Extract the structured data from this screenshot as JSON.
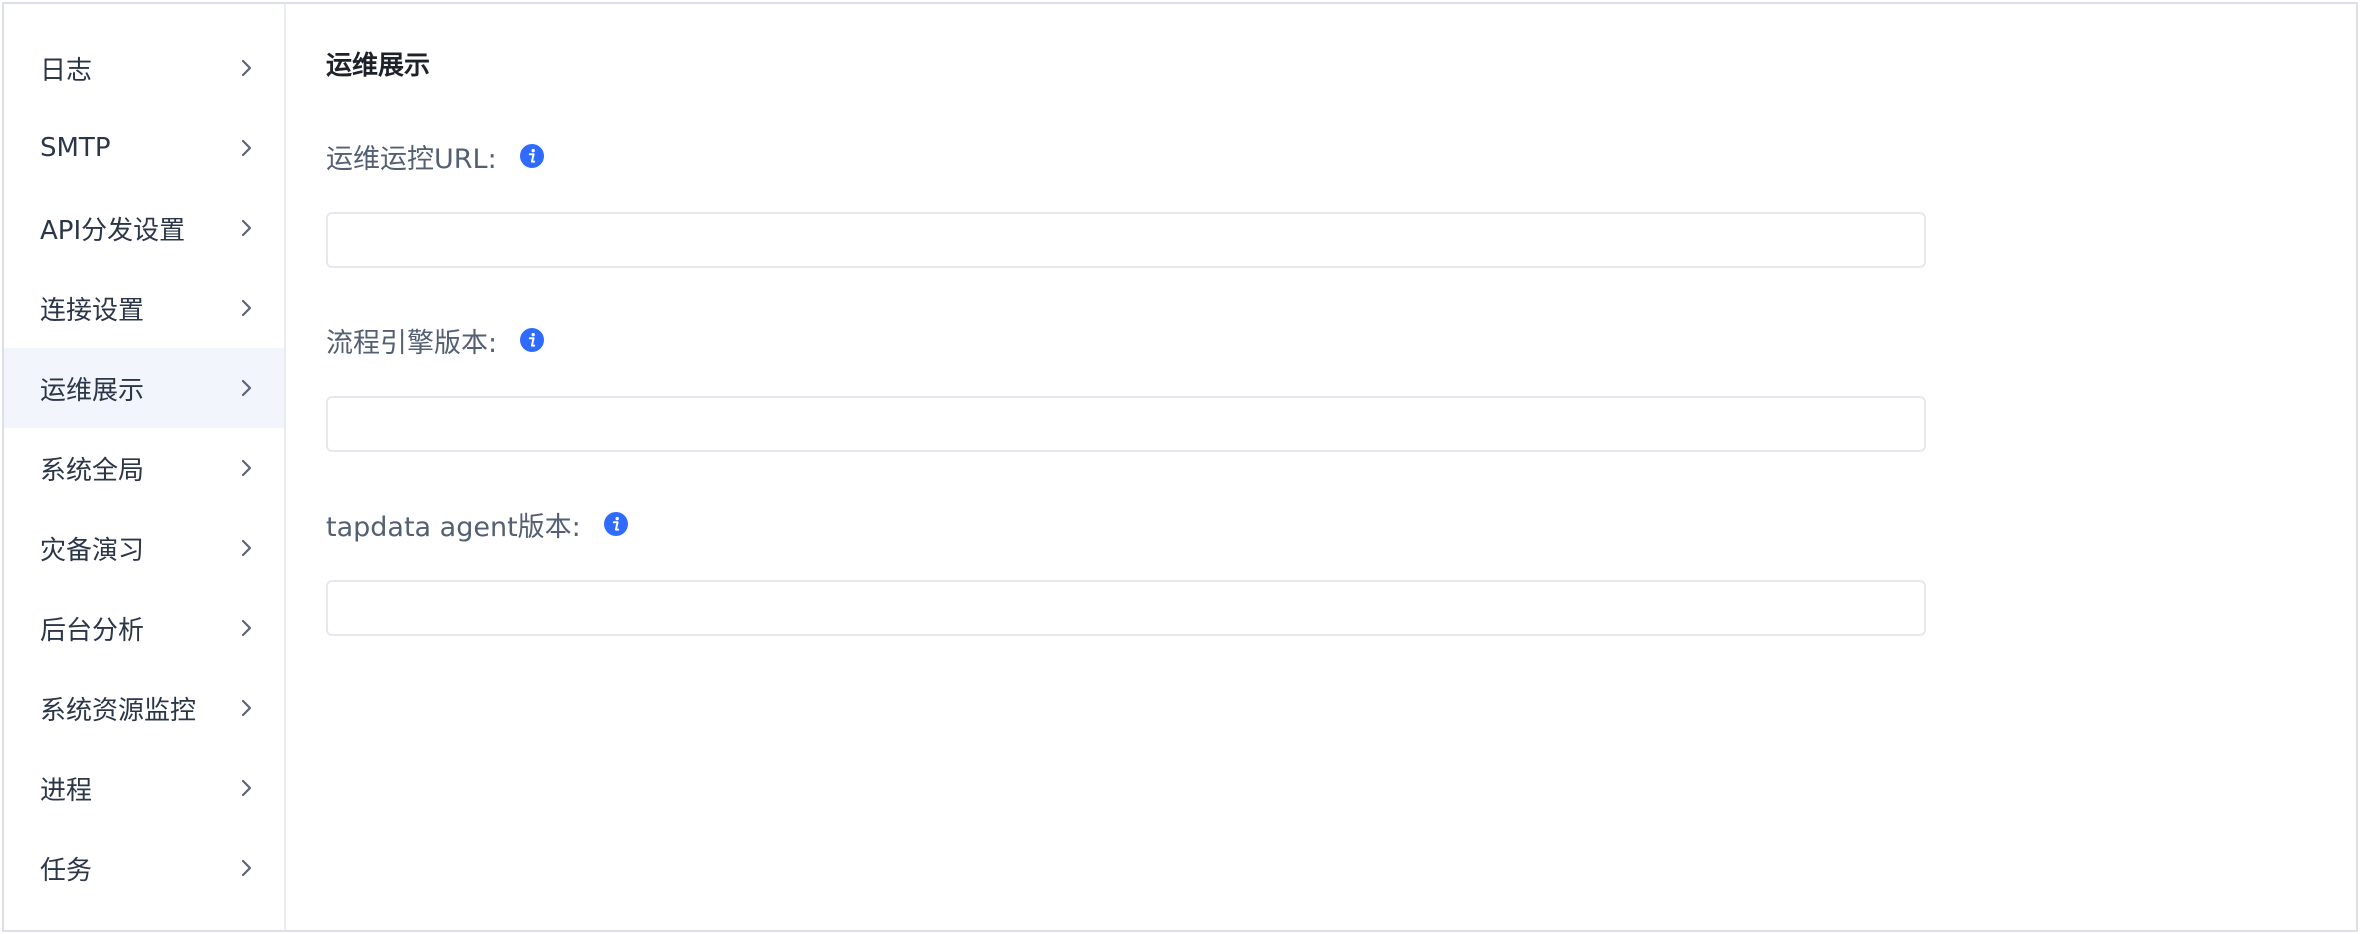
{
  "sidebar": {
    "items": [
      {
        "label": "日志",
        "active": false
      },
      {
        "label": "SMTP",
        "active": false
      },
      {
        "label": "API分发设置",
        "active": false
      },
      {
        "label": "连接设置",
        "active": false
      },
      {
        "label": "运维展示",
        "active": true
      },
      {
        "label": "系统全局",
        "active": false
      },
      {
        "label": "灾备演习",
        "active": false
      },
      {
        "label": "后台分析",
        "active": false
      },
      {
        "label": "系统资源监控",
        "active": false
      },
      {
        "label": "进程",
        "active": false
      },
      {
        "label": "任务",
        "active": false
      }
    ],
    "chevron_icon": "chevron-right-icon"
  },
  "main": {
    "title": "运维展示",
    "fields": [
      {
        "label": "运维运控URL:",
        "value": "",
        "placeholder": "",
        "icon": "info-icon"
      },
      {
        "label": "流程引擎版本:",
        "value": "",
        "placeholder": "",
        "icon": "info-icon"
      },
      {
        "label": "tapdata agent版本:",
        "value": "",
        "placeholder": "",
        "icon": "info-icon"
      }
    ]
  },
  "colors": {
    "accent": "#2f6bff",
    "active_bg": "#f2f5fb",
    "border": "#e6e8ee"
  }
}
